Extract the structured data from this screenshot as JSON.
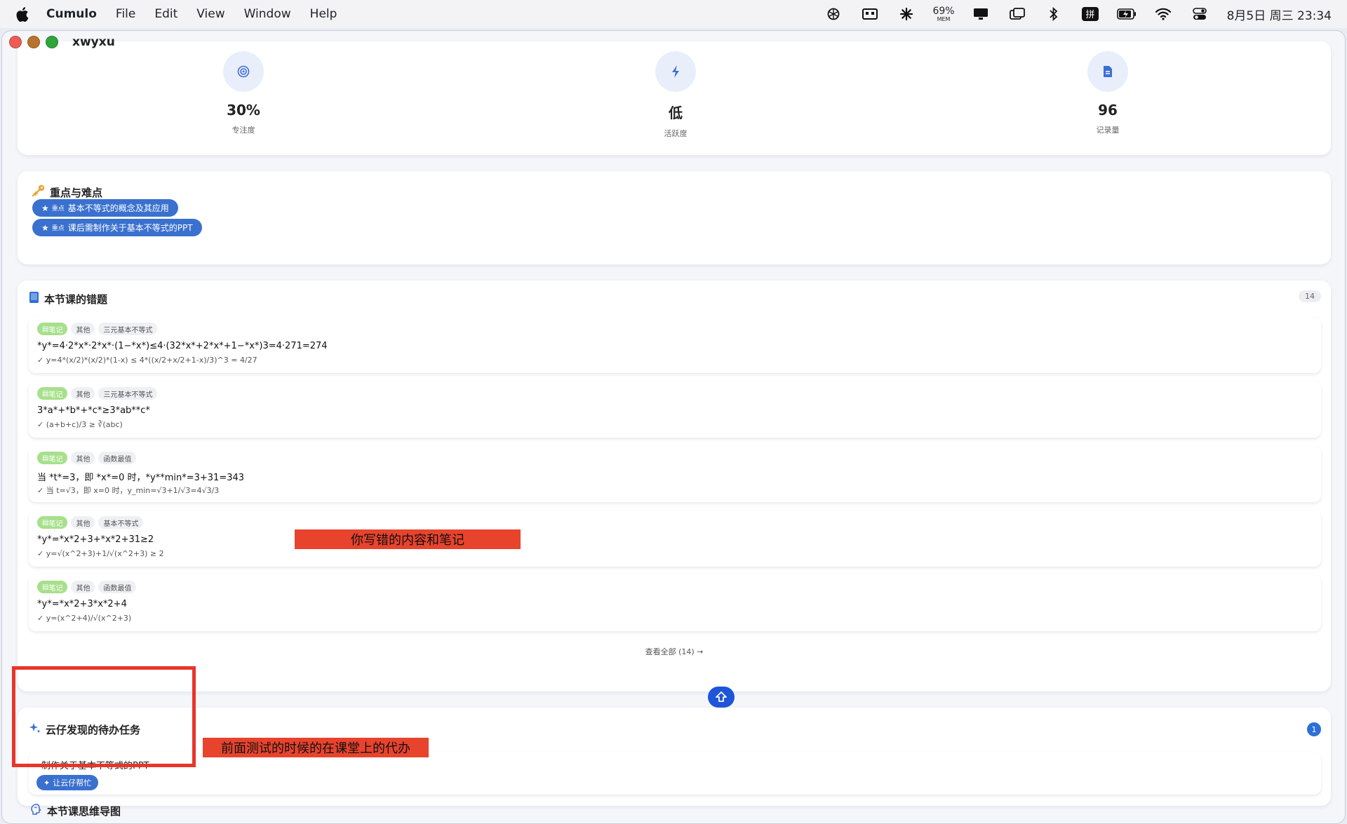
{
  "menubar": {
    "app_name": "Cumulo",
    "menus": [
      "File",
      "Edit",
      "View",
      "Window",
      "Help"
    ],
    "mem_percent": "69%",
    "mem_label": "MEM",
    "clock": "8月5日 周三 23:34"
  },
  "window": {
    "title": "xwyxu"
  },
  "stats": [
    {
      "value": "30%",
      "label": "专注度",
      "icon": "target-icon"
    },
    {
      "value": "低",
      "label": "活跃度",
      "icon": "lightning-icon"
    },
    {
      "value": "96",
      "label": "记录量",
      "icon": "document-icon"
    }
  ],
  "key_points": {
    "title": "重点与难点",
    "tag": "重点",
    "items": [
      "基本不等式的概念及其应用",
      "课后需制作关于基本不等式的PPT"
    ]
  },
  "mistakes": {
    "title": "本节课的错题",
    "count": "14",
    "items": [
      {
        "badges": [
          "笔记",
          "其他",
          "三元基本不等式"
        ],
        "question": "*y*=4·2*x*·2*x*·(1−*x*)≤4·(32*x*+2*x*+1−*x*)3=4·271=274",
        "answer": "✓ y=4*(x/2)*(x/2)*(1-x) ≤ 4*((x/2+x/2+1-x)/3)^3 = 4/27"
      },
      {
        "badges": [
          "笔记",
          "其他",
          "三元基本不等式"
        ],
        "question": "3*a*+*b*+*c*≥3*ab**c*",
        "answer": "✓ (a+b+c)/3 ≥ ∛(abc)"
      },
      {
        "badges": [
          "笔记",
          "其他",
          "函数最值"
        ],
        "question": "当 *t*=3，即 *x*=0 时，*y**min*=3+31=343",
        "answer": "✓ 当 t=√3，即 x=0 时，y_min=√3+1/√3=4√3/3"
      },
      {
        "badges": [
          "笔记",
          "其他",
          "基本不等式"
        ],
        "question": "*y*=*x*2+3+*x*2+31≥2",
        "answer": "✓ y=√(x^2+3)+1/√(x^2+3) ≥ 2"
      },
      {
        "badges": [
          "笔记",
          "其他",
          "函数最值"
        ],
        "question": "*y*=*x*2+3*x*2+4",
        "answer": "✓ y=(x^2+4)/√(x^2+3)"
      }
    ],
    "view_all": "查看全部 (14) →"
  },
  "annotations": {
    "mistakes_note": "你写错的内容和笔记",
    "todo_note": "前面测试的时候的在课堂上的代办"
  },
  "todos": {
    "title": "云仔发现的待办任务",
    "count": "1",
    "items": [
      {
        "text": "制作关于基本不等式的PPT",
        "button": "让云仔帮忙"
      }
    ]
  },
  "mindmap": {
    "title": "本节课思维导图"
  },
  "colors": {
    "accent": "#3a71cf",
    "note_badge": "#a7e08c",
    "annotation_red": "#e8432d"
  }
}
